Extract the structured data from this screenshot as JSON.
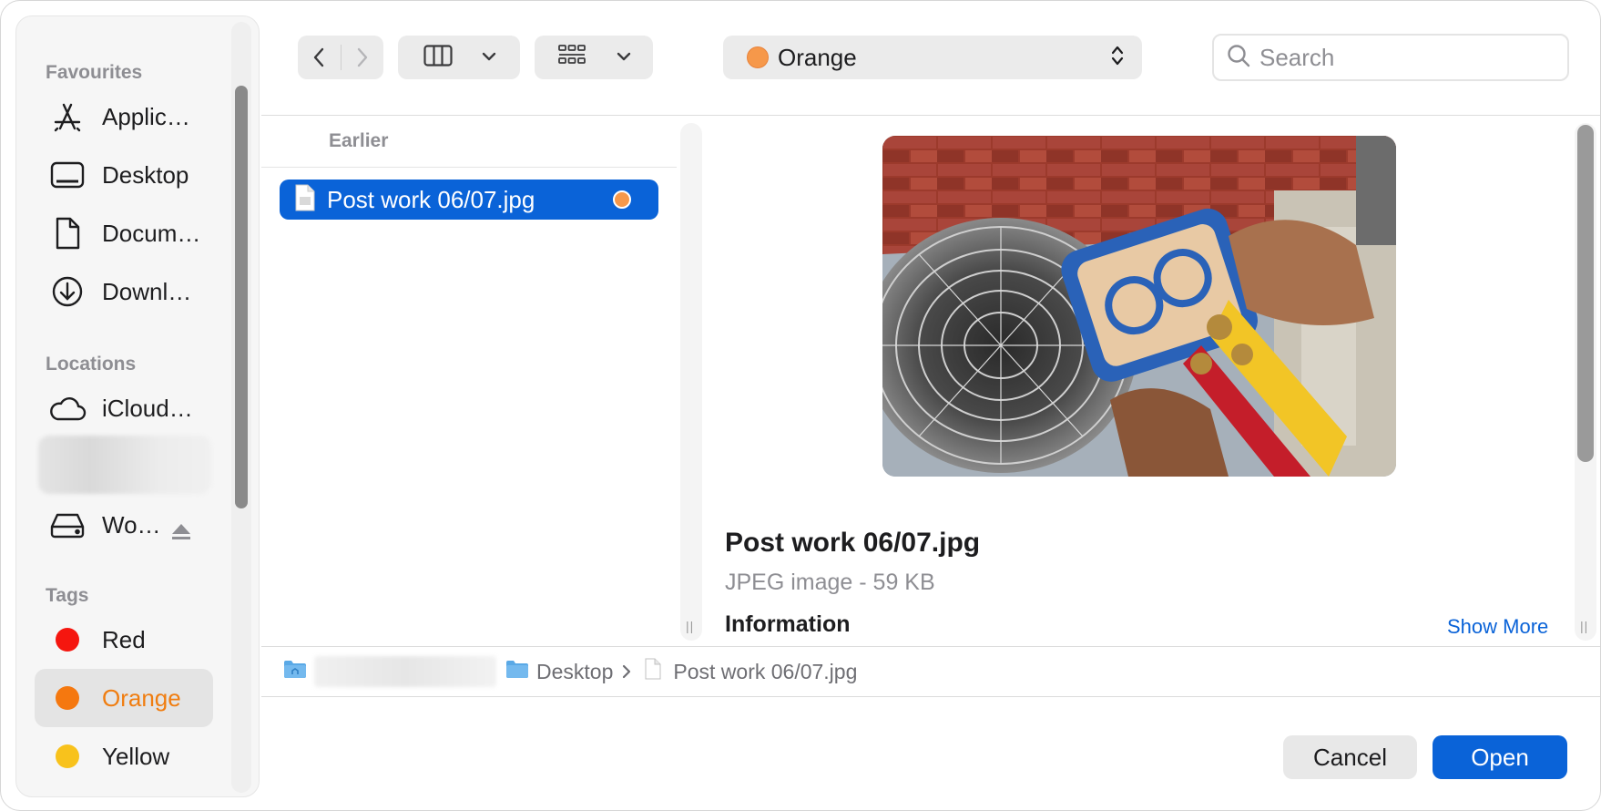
{
  "sidebar": {
    "favourites_title": "Favourites",
    "favourites": [
      {
        "label": "Applic…",
        "icon": "applications-icon"
      },
      {
        "label": "Desktop",
        "icon": "desktop-icon"
      },
      {
        "label": "Docum…",
        "icon": "document-icon"
      },
      {
        "label": "Downl…",
        "icon": "downloads-icon"
      }
    ],
    "locations_title": "Locations",
    "locations": [
      {
        "label": "iCloud…",
        "icon": "cloud-icon"
      },
      {
        "label": "Wo…",
        "icon": "drive-icon"
      }
    ],
    "tags_title": "Tags",
    "tags": [
      {
        "label": "Red",
        "color": "#f5160f"
      },
      {
        "label": "Orange",
        "color": "#f5780f",
        "active": true
      },
      {
        "label": "Yellow",
        "color": "#f8c21c"
      }
    ]
  },
  "toolbar": {
    "location_label": "Orange",
    "location_color": "#f6984a",
    "search_placeholder": "Search"
  },
  "file_list": {
    "section_header": "Earlier",
    "selected_file": "Post work 06/07.jpg",
    "tag_color": "#f6984a"
  },
  "preview": {
    "title": "Post work 06/07.jpg",
    "subtitle": "JPEG image - 59 KB",
    "info_heading": "Information",
    "show_more": "Show More"
  },
  "pathbar": {
    "folder": "Desktop",
    "file": "Post work 06/07.jpg"
  },
  "buttons": {
    "cancel": "Cancel",
    "open": "Open"
  },
  "colors": {
    "accent": "#0a63d8"
  }
}
